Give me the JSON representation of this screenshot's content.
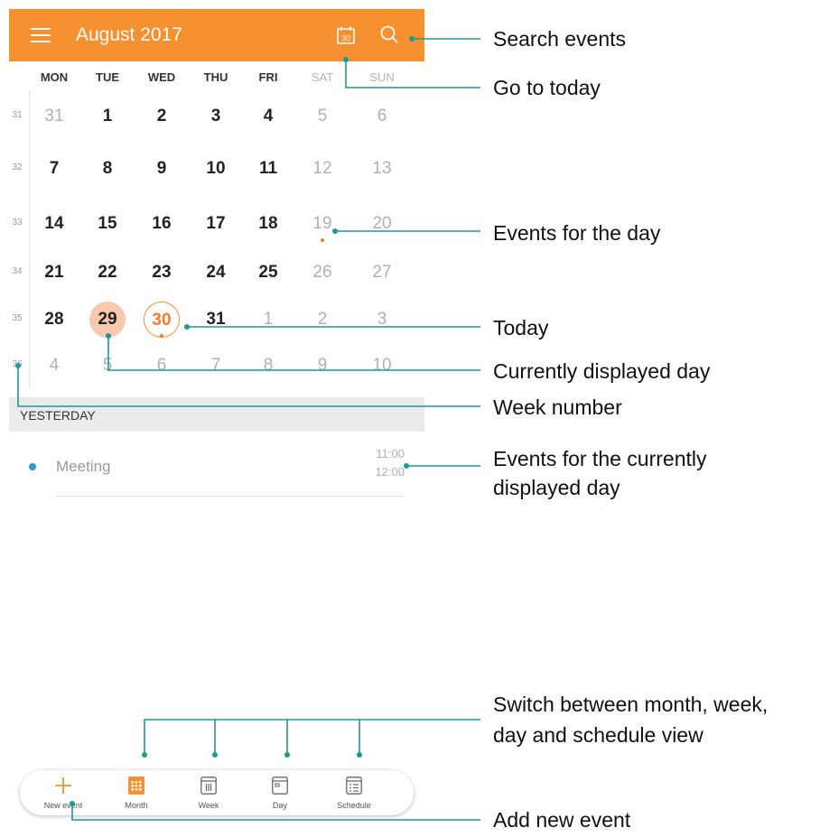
{
  "header": {
    "title": "August 2017",
    "accent_color": "#f7902f",
    "menu_icon": "menu-icon",
    "today_icon": "calendar-today-icon",
    "search_icon": "search-icon",
    "today_icon_day": "30"
  },
  "weekdays": [
    "MON",
    "TUE",
    "WED",
    "THU",
    "FRI",
    "SAT",
    "SUN"
  ],
  "weeks": [
    {
      "number": "31",
      "days": [
        "31",
        "1",
        "2",
        "3",
        "4",
        "5",
        "6"
      ]
    },
    {
      "number": "32",
      "days": [
        "7",
        "8",
        "9",
        "10",
        "11",
        "12",
        "13"
      ]
    },
    {
      "number": "33",
      "days": [
        "14",
        "15",
        "16",
        "17",
        "18",
        "19",
        "20"
      ]
    },
    {
      "number": "34",
      "days": [
        "21",
        "22",
        "23",
        "24",
        "25",
        "26",
        "27"
      ]
    },
    {
      "number": "35",
      "days": [
        "28",
        "29",
        "30",
        "31",
        "1",
        "2",
        "3"
      ]
    },
    {
      "number": "36",
      "days": [
        "4",
        "5",
        "6",
        "7",
        "8",
        "9",
        "10"
      ]
    }
  ],
  "selected_day": "29",
  "today": "30",
  "section_header": "YESTERDAY",
  "event": {
    "title": "Meeting",
    "start": "11:00",
    "end": "12:00",
    "color": "#2b9bd8"
  },
  "bottom_nav": [
    {
      "label": "New event",
      "icon": "plus-icon"
    },
    {
      "label": "Month",
      "icon": "month-view-icon"
    },
    {
      "label": "Week",
      "icon": "week-view-icon"
    },
    {
      "label": "Day",
      "icon": "day-view-icon"
    },
    {
      "label": "Schedule",
      "icon": "schedule-view-icon"
    }
  ],
  "callouts": {
    "search": "Search events",
    "today_btn": "Go to today",
    "events_day": "Events for the day",
    "today": "Today",
    "current_day": "Currently displayed day",
    "week_number": "Week number",
    "events_current_1": "Events for the currently",
    "events_current_2": "displayed day",
    "switch_1": "Switch between month, week,",
    "switch_2": "day and schedule view",
    "add_event": "Add new event"
  },
  "callout_line_color": "#1a9a98"
}
